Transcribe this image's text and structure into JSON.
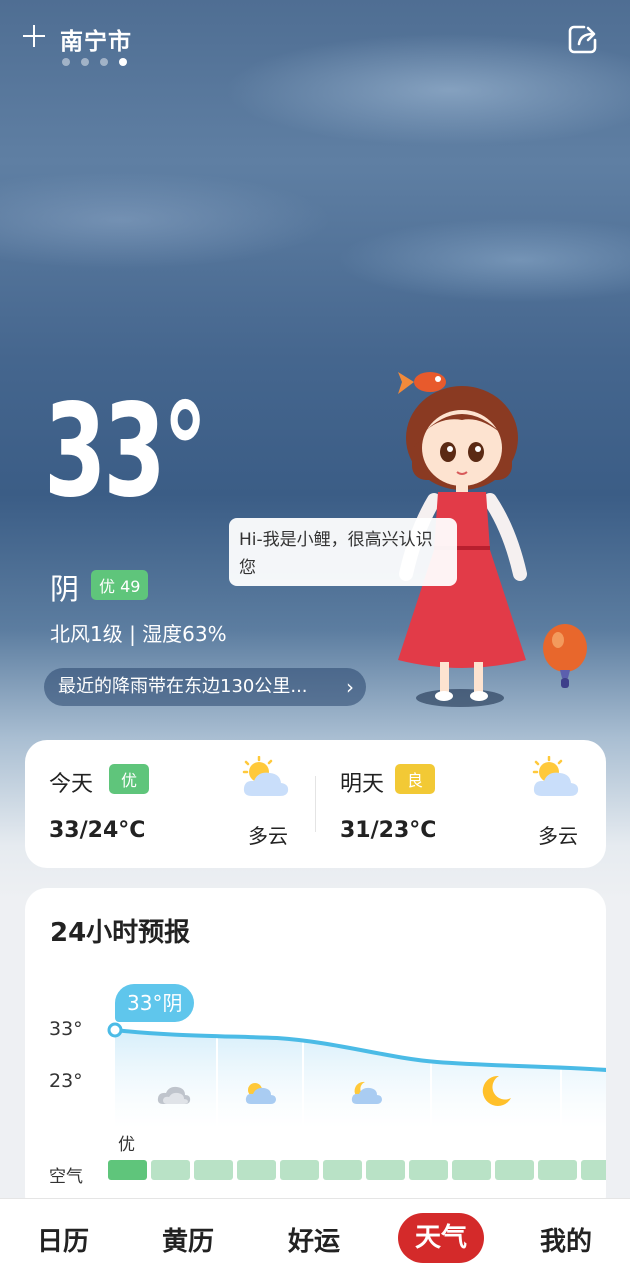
{
  "header": {
    "city": "南宁市",
    "page_count": 4,
    "active_page": 4
  },
  "current": {
    "temperature": "33°",
    "condition": "阴",
    "aqi_badge": "优 49",
    "wind_humidity": "北风1级 | 湿度63%",
    "rain_notice": "最近的降雨带在东边130公里...",
    "rain_chevron": "›"
  },
  "mascot": {
    "speech": "Hi-我是小鲤，很高兴认识您"
  },
  "daily": {
    "today": {
      "label": "今天",
      "aqi": "优",
      "aqi_color": "#5fc57b",
      "temp": "33/24°C",
      "condition": "多云",
      "icon": "partly-cloudy-icon"
    },
    "tomorrow": {
      "label": "明天",
      "aqi": "良",
      "aqi_color": "#f2c935",
      "temp": "31/23°C",
      "condition": "多云",
      "icon": "partly-cloudy-icon"
    }
  },
  "hourly": {
    "title": "24小时预报",
    "y_high": "33°",
    "y_low": "23°",
    "current_bubble": "33°阴",
    "aqi_first_label": "优",
    "aqi_row_label": "空气",
    "icons": [
      "cloudy-icon",
      "partly-cloudy-icon",
      "partly-cloudy-night-icon",
      "moon-icon",
      "partly-cloudy-icon"
    ],
    "aqi_cells": 12
  },
  "tabs": [
    {
      "label": "日历",
      "active": false
    },
    {
      "label": "黄历",
      "active": false
    },
    {
      "label": "好运",
      "active": false
    },
    {
      "label": "天气",
      "active": true
    },
    {
      "label": "我的",
      "active": false
    }
  ],
  "colors": {
    "accent_red": "#d42a2a",
    "aqi_good": "#5fc57b",
    "aqi_moderate": "#f2c935",
    "temp_line": "#4bbbe6"
  }
}
